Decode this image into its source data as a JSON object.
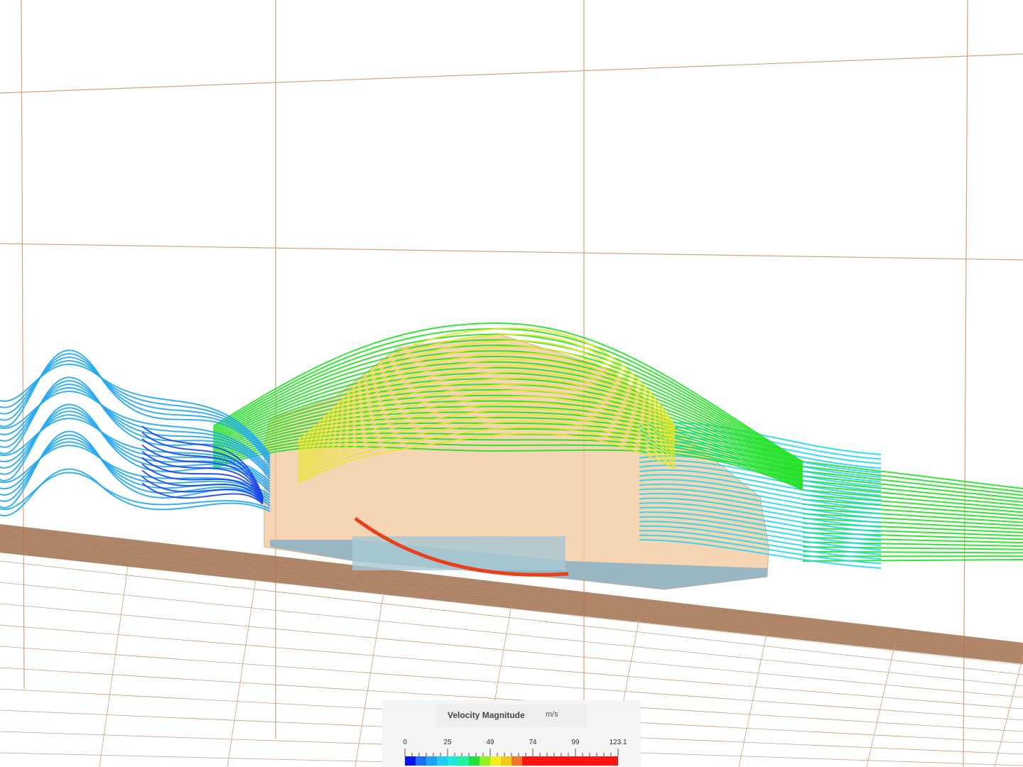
{
  "legend": {
    "title": "Velocity Magnitude",
    "unit": "m/s",
    "ticks": [
      "0",
      "25",
      "49",
      "74",
      "99",
      "123.1"
    ],
    "colors": [
      "#0a14f0",
      "#1e6ef5",
      "#1ea0f5",
      "#1ecdf5",
      "#20e8d8",
      "#20f0a0",
      "#20e040",
      "#90f020",
      "#f0f020",
      "#f5c81e",
      "#f07828",
      "#ff1414",
      "#ff1414",
      "#ff1414",
      "#ff1414",
      "#ff1414",
      "#ff1414",
      "#ff1414",
      "#ff1414",
      "#ff1414"
    ]
  },
  "colors": {
    "grid": "#d9a27a",
    "floor": "#9b6b4a",
    "body_fill": "#f2c89a",
    "body_base": "#8fb4c4",
    "stream_slow": "#1a44e6",
    "stream_blue": "#22a6f0",
    "stream_cyan": "#20d8f0",
    "stream_green": "#20e020",
    "stream_yellow": "#e8e820",
    "stream_red": "#e8401a"
  }
}
